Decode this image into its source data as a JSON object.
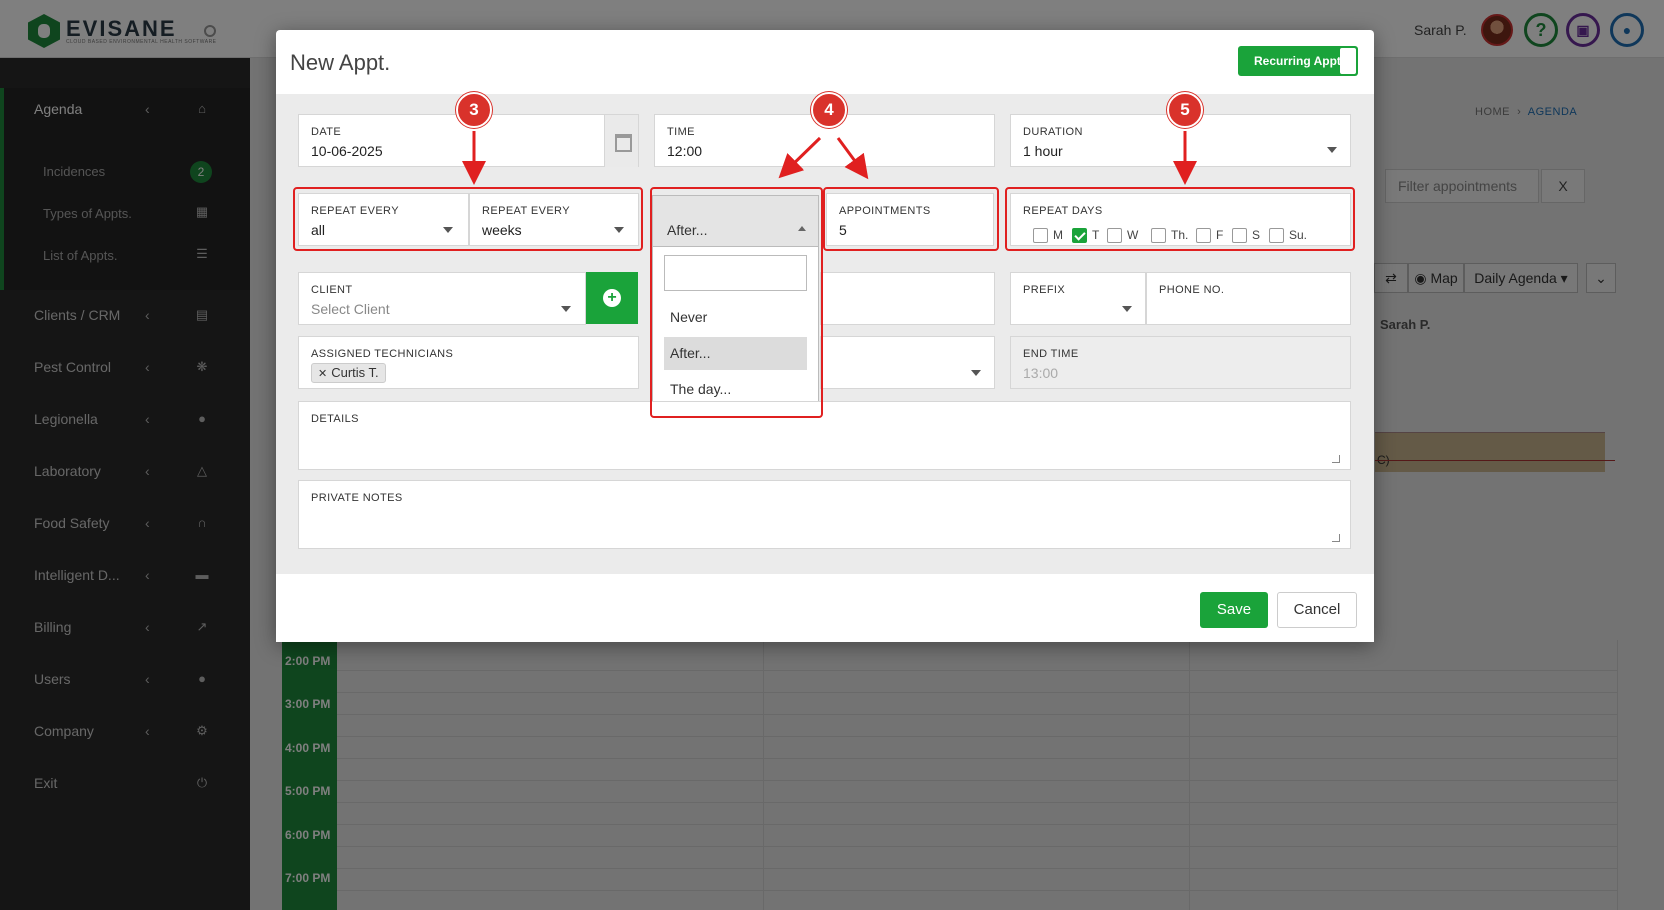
{
  "app": {
    "logo_name": "EVISANE",
    "logo_tagline": "CLOUD BASED ENVIRONMENTAL HEALTH SOFTWARE"
  },
  "header": {
    "user_name": "Sarah P.",
    "icons": [
      "help-icon",
      "gift-icon",
      "chat-icon"
    ]
  },
  "sidebar": {
    "items": [
      {
        "label": "Agenda",
        "icon": "home-icon"
      },
      {
        "label": "Clients / CRM",
        "icon": "id-card-icon"
      },
      {
        "label": "Pest Control",
        "icon": "bug-icon"
      },
      {
        "label": "Legionella",
        "icon": "drop-icon"
      },
      {
        "label": "Laboratory",
        "icon": "flask-icon"
      },
      {
        "label": "Food Safety",
        "icon": "cutlery-icon"
      },
      {
        "label": "Intelligent D...",
        "icon": "folder-icon"
      },
      {
        "label": "Billing",
        "icon": "chart-icon"
      },
      {
        "label": "Users",
        "icon": "user-icon"
      },
      {
        "label": "Company",
        "icon": "gear-icon"
      },
      {
        "label": "Exit",
        "icon": "power-icon"
      }
    ],
    "sub_items": [
      {
        "label": "Incidences",
        "badge": "2"
      },
      {
        "label": "Types of Appts.",
        "icon": "calendar-icon"
      },
      {
        "label": "List of Appts.",
        "icon": "list-icon"
      }
    ]
  },
  "background": {
    "breadcrumb_home": "HOME",
    "breadcrumb_current": "AGENDA",
    "filter_placeholder": "Filter appointments",
    "filter_clear": "X",
    "toolbar_map": "Map",
    "toolbar_view": "Daily Agenda",
    "column_header": "Sarah P.",
    "event_text": "C)",
    "times": [
      "2:00 PM",
      "3:00 PM",
      "4:00 PM",
      "5:00 PM",
      "6:00 PM",
      "7:00 PM"
    ]
  },
  "modal": {
    "title": "New Appt.",
    "recurring_toggle": "Recurring Appt.",
    "recurring_on": true,
    "date": {
      "label": "DATE",
      "value": "10-06-2025"
    },
    "time": {
      "label": "TIME",
      "value": "12:00"
    },
    "duration": {
      "label": "DURATION",
      "value": "1 hour"
    },
    "repeat_every_1": {
      "label": "REPEAT EVERY",
      "value": "all"
    },
    "repeat_every_2": {
      "label": "REPEAT EVERY",
      "value": "weeks"
    },
    "end_mode": {
      "value": "After...",
      "options": [
        "Never",
        "After...",
        "The day..."
      ],
      "selected": "After..."
    },
    "appointments": {
      "label": "APPOINTMENTS",
      "value": "5"
    },
    "repeat_days": {
      "label": "REPEAT DAYS",
      "days": [
        {
          "label": "M",
          "checked": false
        },
        {
          "label": "T",
          "checked": true
        },
        {
          "label": "W",
          "checked": false
        },
        {
          "label": "Th.",
          "checked": false
        },
        {
          "label": "F",
          "checked": false
        },
        {
          "label": "S",
          "checked": false
        },
        {
          "label": "Su.",
          "checked": false
        }
      ]
    },
    "client": {
      "label": "CLIENT",
      "placeholder": "Select Client"
    },
    "prefix": {
      "label": "PREFIX",
      "value": ""
    },
    "phone": {
      "label": "PHONE NO.",
      "value": ""
    },
    "technicians": {
      "label": "ASSIGNED TECHNICIANS",
      "tags": [
        "Curtis T."
      ]
    },
    "end_time": {
      "label": "END TIME",
      "value": "13:00"
    },
    "details": {
      "label": "DETAILS",
      "value": ""
    },
    "private_notes": {
      "label": "PRIVATE NOTES",
      "value": ""
    },
    "save_label": "Save",
    "cancel_label": "Cancel"
  },
  "annotations": [
    {
      "number": "3"
    },
    {
      "number": "4"
    },
    {
      "number": "5"
    }
  ],
  "colors": {
    "brand_green": "#1aa33a",
    "sidebar_bg": "#2b2b2b",
    "annotation_red": "#e02020",
    "link_blue": "#1f6fb4"
  }
}
